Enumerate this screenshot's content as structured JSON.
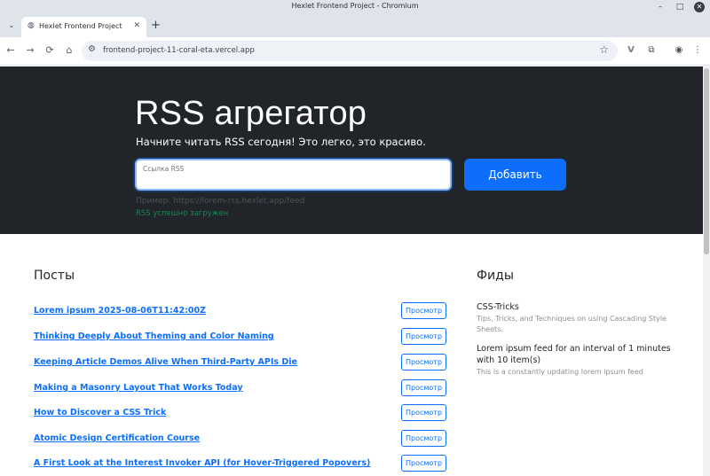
{
  "window": {
    "title": "Hexlet Frontend Project - Chromium",
    "minimize": "–",
    "maximize": "□",
    "close": "✕"
  },
  "tabs": [
    {
      "title": "Hexlet Frontend Project",
      "close": "✕"
    }
  ],
  "tabstrip": {
    "menu": "⌄",
    "new_tab": "+"
  },
  "toolbar": {
    "url": "frontend-project-11-coral-eta.vercel.app"
  },
  "icons": {
    "back": "←",
    "forward": "→",
    "reload": "⟳",
    "home": "⌂",
    "tune": "⚙",
    "star": "☆",
    "vivaldi": "V",
    "extensions": "⧉",
    "profile": "◉",
    "menu": "⋮",
    "globe": "◍"
  },
  "hero": {
    "title": "RSS агрегатор",
    "lead": "Начните читать RSS сегодня! Это легко, это красиво.",
    "input_placeholder": "Ссылка RSS",
    "add_button": "Добавить",
    "example": "Пример: https://lorem-rss.hexlet.app/feed",
    "feedback": "RSS успешно загружен"
  },
  "posts": {
    "title": "Посты",
    "view_label": "Просмотр",
    "items": [
      "Lorem ipsum 2025-08-06T11:42:00Z",
      "Thinking Deeply About Theming and Color Naming",
      "Keeping Article Demos Alive When Third-Party APIs Die",
      "Making a Masonry Layout That Works Today",
      "How to Discover a CSS Trick",
      "Atomic Design Certification Course",
      "A First Look at the Interest Invoker API (for Hover-Triggered Popovers)"
    ]
  },
  "feeds": {
    "title": "Фиды",
    "items": [
      {
        "title": "CSS-Tricks",
        "description": "Tips, Tricks, and Techniques on using Cascading Style Sheets."
      },
      {
        "title": "Lorem ipsum feed for an interval of 1 minutes with 10 item(s)",
        "description": "This is a constantly updating lorem ipsum feed"
      }
    ]
  }
}
